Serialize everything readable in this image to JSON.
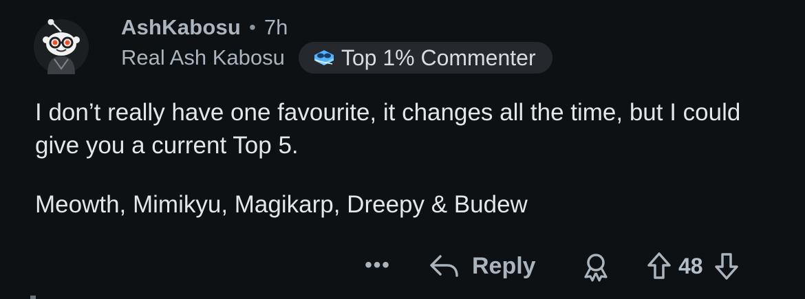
{
  "comment": {
    "author": {
      "username": "AshKabosu",
      "flair": "Real Ash Kabosu",
      "avatar_icon": "snoo-avatar-icon"
    },
    "age": "7h",
    "separator": "•",
    "badge": {
      "label": "Top 1% Commenter",
      "icon": "commenter-badge-icon"
    },
    "body": [
      "I don’t really have one favourite, it changes all the time, but I could give you a current Top 5.",
      "Meowth, Mimikyu, Magikarp, Dreepy & Budew"
    ],
    "actions": {
      "more_label": "•••",
      "reply_label": "Reply",
      "award_icon": "award-icon",
      "vote_count": "48"
    }
  },
  "colors": {
    "background": "#0e1113",
    "text": "#e3e7ea",
    "muted": "#a9b4bd",
    "badge_bg": "#25292d"
  }
}
